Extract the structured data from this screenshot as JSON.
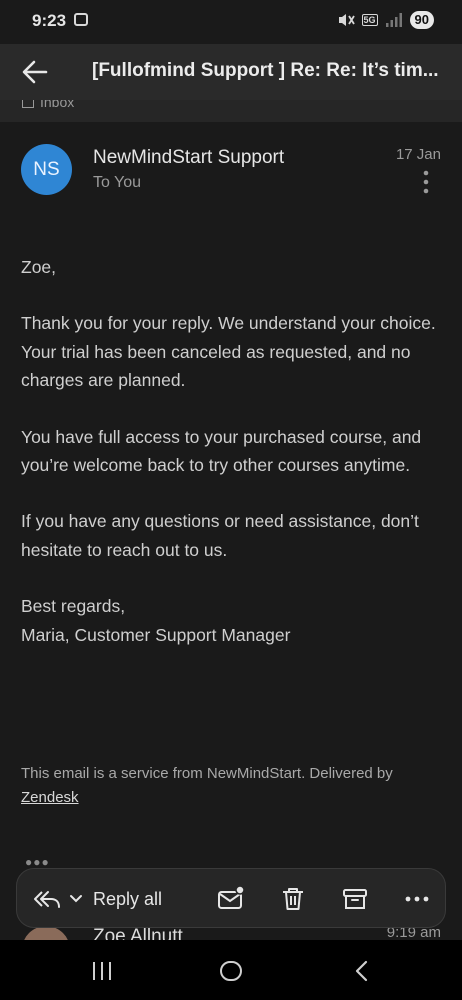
{
  "status_bar": {
    "time": "9:23",
    "network": "5G",
    "battery": "90"
  },
  "header_bar": {
    "subject": "[Fullofmind Support ] Re: Re: It’s tim..."
  },
  "folder": {
    "label": "Inbox"
  },
  "message": {
    "avatar_initials": "NS",
    "avatar_color": "#2f86d4",
    "sender": "NewMindStart Support",
    "recipient": "To You",
    "date": "17 Jan",
    "body": {
      "greeting": "Zoe,",
      "p1_line1": "Thank you for your reply. We understand your choice.",
      "p1_line2": "Your trial has been canceled as requested, and no charges are planned.",
      "p2": "You have full access to your purchased course, and you’re welcome back to try other courses anytime.",
      "p3": "If you have any questions or need assistance, don’t hesitate to reach out to us.",
      "signoff": "Best regards,",
      "signature": "Maria, Customer Support Manager"
    },
    "footer_text": "This email is a service from NewMindStart. Delivered by",
    "footer_link": "Zendesk"
  },
  "next_message": {
    "sender": "Zoe Allnutt",
    "time": "9:19 am"
  },
  "action_bar": {
    "reply_all_label": "Reply all"
  },
  "icons": {
    "back": "arrow-left-icon",
    "more": "kebab-icon",
    "reply_all": "reply-all-icon",
    "unread": "mail-unread-icon",
    "delete": "trash-icon",
    "archive": "archive-icon",
    "overflow": "more-horizontal-icon"
  }
}
